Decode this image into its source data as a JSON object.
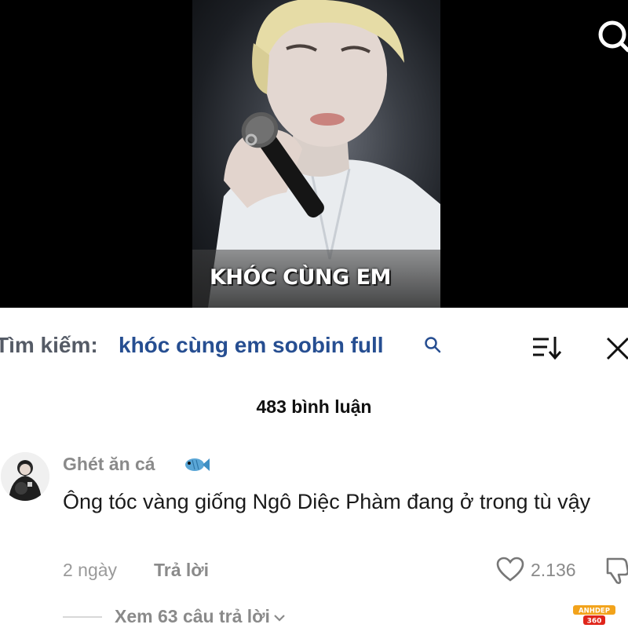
{
  "video": {
    "caption": "KHÓC CÙNG EM",
    "search_icon": "search-icon"
  },
  "search_bar": {
    "label": "Tìm kiếm:",
    "query": "khóc cùng em soobin full",
    "sort_icon": "sort-icon",
    "close_icon": "close-icon"
  },
  "comments": {
    "count_text": "483 bình luận",
    "items": [
      {
        "username": "Ghét ăn cá",
        "username_emoji": "fish-icon",
        "text": "Ông tóc vàng giống Ngô Diệc Phàm đang ở trong tù vậy",
        "time": "2 ngày",
        "reply_label": "Trả lời",
        "like_count": "2.136",
        "view_replies": "Xem 63 câu trả lời"
      }
    ]
  },
  "watermark": {
    "line1": "ANHDEP",
    "line2": "360"
  },
  "colors": {
    "query": "#264e91",
    "muted": "#8a8a8a",
    "video_bg": "#000000"
  }
}
